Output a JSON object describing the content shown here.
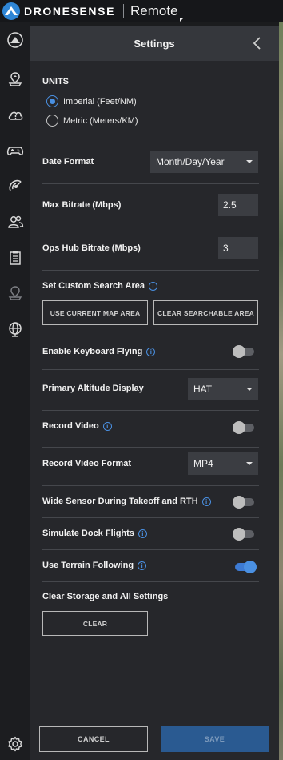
{
  "app": {
    "brand": "DRONESENSE",
    "product": "Remote"
  },
  "panel": {
    "title": "Settings"
  },
  "units": {
    "label": "UNITS",
    "options": [
      {
        "label": "Imperial (Feet/NM)",
        "selected": true
      },
      {
        "label": "Metric (Meters/KM)",
        "selected": false
      }
    ]
  },
  "date_format": {
    "label": "Date Format",
    "value": "Month/Day/Year"
  },
  "max_bitrate": {
    "label": "Max Bitrate (Mbps)",
    "value": "2.5"
  },
  "ops_hub_bitrate": {
    "label": "Ops Hub Bitrate (Mbps)",
    "value": "3"
  },
  "search_area": {
    "label": "Set Custom Search Area",
    "use_current_button": "USE CURRENT MAP AREA",
    "clear_button": "CLEAR SEARCHABLE AREA"
  },
  "keyboard_flying": {
    "label": "Enable Keyboard Flying",
    "enabled": false
  },
  "altitude_display": {
    "label": "Primary Altitude Display",
    "value": "HAT"
  },
  "record_video": {
    "label": "Record Video",
    "enabled": false
  },
  "record_video_format": {
    "label": "Record Video Format",
    "value": "MP4"
  },
  "wide_sensor": {
    "label": "Wide Sensor During Takeoff and RTH",
    "enabled": false
  },
  "simulate_dock": {
    "label": "Simulate Dock Flights",
    "enabled": false
  },
  "terrain_following": {
    "label": "Use Terrain Following",
    "enabled": true
  },
  "clear_storage": {
    "label": "Clear Storage and All Settings",
    "button": "CLEAR"
  },
  "footer": {
    "cancel": "CANCEL",
    "save": "SAVE"
  },
  "info_glyph": "i",
  "rail_icons": [
    "fleet-icon",
    "location-icon",
    "cloud-alert-icon",
    "gamepad-icon",
    "satellite-icon",
    "users-icon",
    "clipboard-icon",
    "map-pin-icon",
    "globe-network-icon",
    "settings-icon"
  ],
  "colors": {
    "accent": "#4a90e2",
    "panel": "#26272b",
    "header": "#35373c",
    "save": "#2a5a91"
  }
}
